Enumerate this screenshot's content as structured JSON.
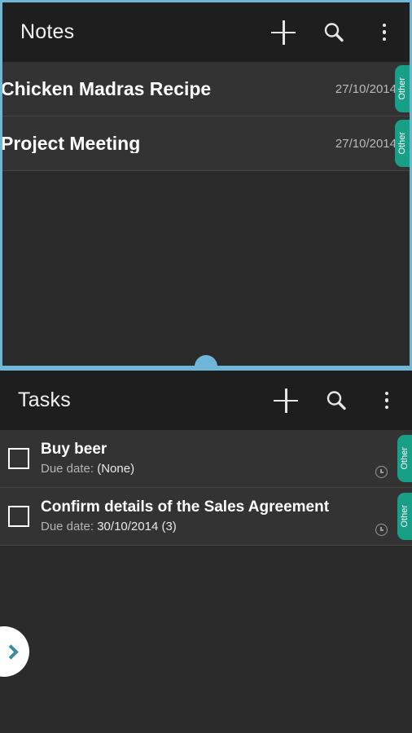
{
  "notes_pane": {
    "header": {
      "title": "Notes",
      "add_icon": "plus-icon",
      "search_icon": "search-icon",
      "overflow_icon": "more-vertical-icon"
    },
    "items": [
      {
        "title": "Chicken Madras Recipe",
        "date": "27/10/2014",
        "category": "Other"
      },
      {
        "title": "Project Meeting",
        "date": "27/10/2014",
        "category": "Other"
      }
    ]
  },
  "splitter": {
    "handle_color": "#6fb6d9"
  },
  "tasks_pane": {
    "header": {
      "title": "Tasks",
      "add_icon": "plus-icon",
      "search_icon": "search-icon",
      "overflow_icon": "more-vertical-icon"
    },
    "items": [
      {
        "title": "Buy beer",
        "due_label": "Due date: ",
        "due_value": "(None)",
        "category": "Other",
        "checked": false,
        "reminder_icon": "clock-icon"
      },
      {
        "title": "Confirm details of the Sales Agreement",
        "due_label": "Due date: ",
        "due_value": "30/10/2014 (3)",
        "category": "Other",
        "checked": false,
        "reminder_icon": "clock-icon"
      }
    ]
  },
  "edge_drawer": {
    "icon": "chevron-right-icon"
  },
  "colors": {
    "accent_teal": "#17a085",
    "focus_blue": "#6fb6d9",
    "actionbar_bg": "#1e1e1e",
    "row_bg": "#333333",
    "page_bg": "#2b2b2b"
  }
}
